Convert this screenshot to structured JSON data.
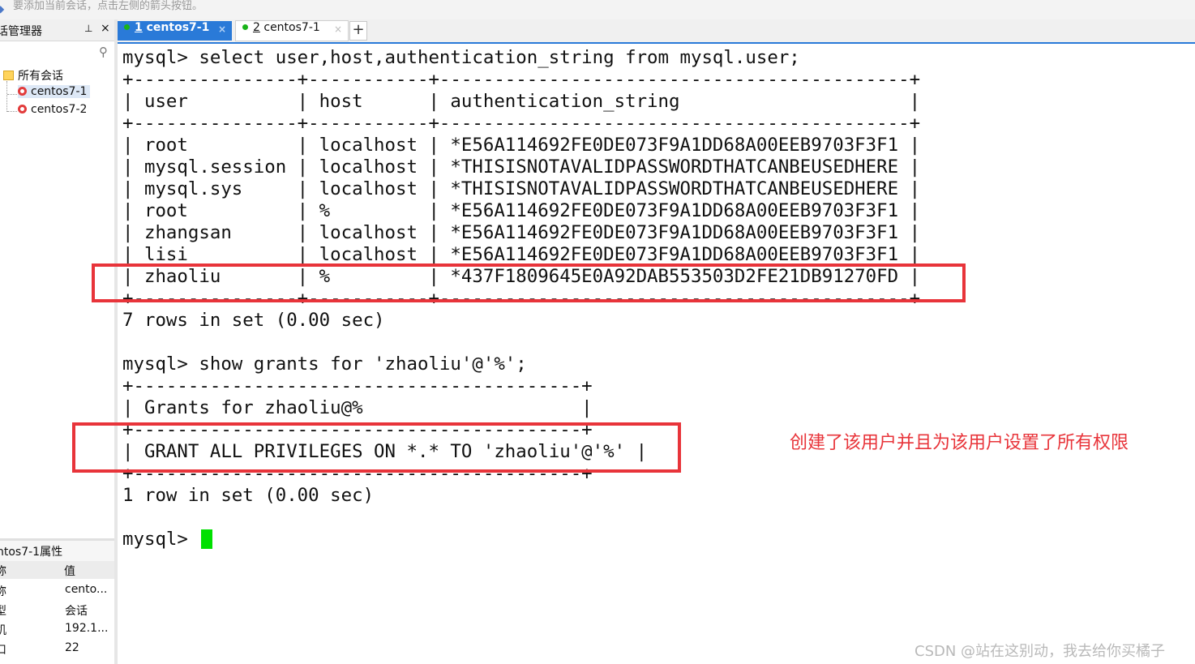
{
  "hint": {
    "text": "要添加当前会话，点击左侧的箭头按钮。"
  },
  "session_manager": {
    "title": "话管理器",
    "pin": "ꟸ",
    "close": "×",
    "tree": [
      {
        "label": "所有会话",
        "icon": "folder-icon"
      },
      {
        "label": "centos7-1",
        "icon": "session-icon",
        "selected": true
      },
      {
        "label": "centos7-2",
        "icon": "session-icon"
      }
    ]
  },
  "properties": {
    "title": "ntos7-1属性",
    "col_name": "称",
    "col_value": "值",
    "rows": [
      {
        "k": "称",
        "v": "cento..."
      },
      {
        "k": "型",
        "v": "会话"
      },
      {
        "k": "机",
        "v": "192.1..."
      },
      {
        "k": "口",
        "v": "22"
      }
    ]
  },
  "tabs": [
    {
      "num": "1",
      "name": "centos7-1",
      "active": true
    },
    {
      "num": "2",
      "name": "centos7-1",
      "active": false
    }
  ],
  "tab_add": "+",
  "terminal": {
    "lines": [
      "mysql> select user,host,authentication_string from mysql.user;",
      "+---------------+-----------+-------------------------------------------+",
      "| user          | host      | authentication_string                     |",
      "+---------------+-----------+-------------------------------------------+",
      "| root          | localhost | *E56A114692FE0DE073F9A1DD68A00EEB9703F3F1 |",
      "| mysql.session | localhost | *THISISNOTAVALIDPASSWORDTHATCANBEUSEDHERE |",
      "| mysql.sys     | localhost | *THISISNOTAVALIDPASSWORDTHATCANBEUSEDHERE |",
      "| root          | %         | *E56A114692FE0DE073F9A1DD68A00EEB9703F3F1 |",
      "| zhangsan      | localhost | *E56A114692FE0DE073F9A1DD68A00EEB9703F3F1 |",
      "| lisi          | localhost | *E56A114692FE0DE073F9A1DD68A00EEB9703F3F1 |",
      "| zhaoliu       | %         | *437F1809645E0A92DAB553503D2FE21DB91270FD |",
      "+---------------+-----------+-------------------------------------------+",
      "7 rows in set (0.00 sec)",
      "",
      "mysql> show grants for 'zhaoliu'@'%';",
      "+-----------------------------------------+",
      "| Grants for zhaoliu@%                    |",
      "+-----------------------------------------+",
      "| GRANT ALL PRIVILEGES ON *.* TO 'zhaoliu'@'%' |",
      "+-----------------------------------------+",
      "1 row in set (0.00 sec)",
      "",
      "mysql> "
    ]
  },
  "annotation": {
    "text": "创建了该用户并且为该用户设置了所有权限",
    "color": "#e8343a"
  },
  "watermark": "CSDN @站在这别动，我去给你买橘子",
  "colors": {
    "accent": "#2a7ad8",
    "cursor": "#00e000",
    "highlight": "#e8343a"
  }
}
